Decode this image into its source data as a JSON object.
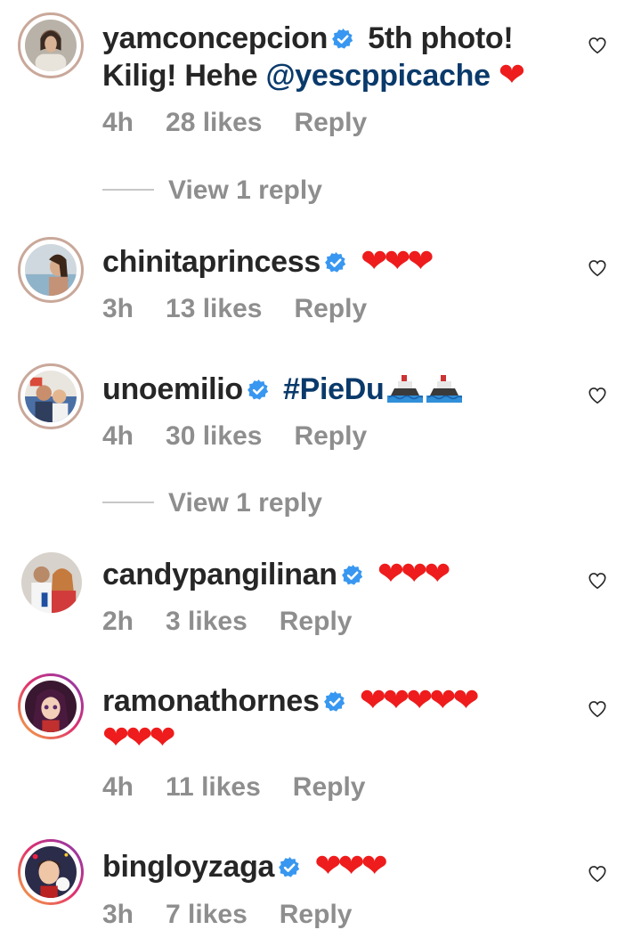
{
  "comments": [
    {
      "username": "yamconcepcion",
      "text_part1": "5th photo!",
      "text_part2": "Kilig! Hehe",
      "mention": "@yescppicache",
      "hearts": "❤",
      "time": "4h",
      "likes": "28 likes",
      "reply": "Reply",
      "view_replies": "View 1 reply"
    },
    {
      "username": "chinitaprincess",
      "hearts": "❤❤❤",
      "time": "3h",
      "likes": "13 likes",
      "reply": "Reply"
    },
    {
      "username": "unoemilio",
      "hashtag": "#PieDu",
      "time": "4h",
      "likes": "30 likes",
      "reply": "Reply",
      "view_replies": "View 1 reply"
    },
    {
      "username": "candypangilinan",
      "hearts": "❤❤❤",
      "time": "2h",
      "likes": "3 likes",
      "reply": "Reply"
    },
    {
      "username": "ramonathornes",
      "hearts_line1": "❤❤❤❤❤",
      "hearts_line2": "❤❤❤",
      "time": "4h",
      "likes": "11 likes",
      "reply": "Reply"
    },
    {
      "username": "bingloyzaga",
      "hearts": "❤❤❤",
      "time": "3h",
      "likes": "7 likes",
      "reply": "Reply"
    }
  ],
  "icons": {
    "verified": "verified-badge-icon",
    "like": "heart-outline-icon",
    "ship": "ship-emoji-icon"
  },
  "colors": {
    "verified_blue": "#3897f0",
    "heart_red": "#ee1c1c",
    "meta_gray": "#8e8e8e",
    "link_blue": "#0a3a6b"
  }
}
